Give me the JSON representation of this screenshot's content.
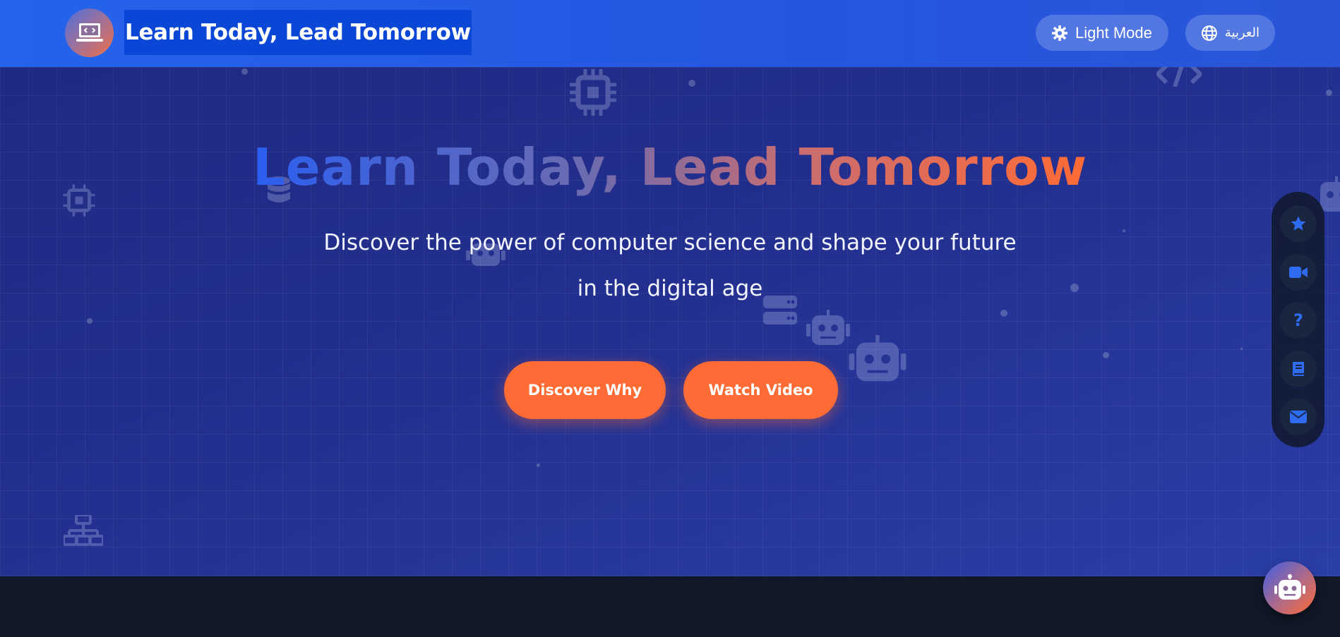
{
  "header": {
    "brand": "Learn Today, Lead Tomorrow",
    "theme_toggle_label": "Light Mode",
    "language_toggle_label": "العربية"
  },
  "hero": {
    "title": "Learn Today, Lead Tomorrow",
    "subtitle": "Discover the power of computer science and shape your future in the digital age",
    "primary_cta": "Discover Why",
    "secondary_cta": "Watch Video"
  },
  "dock": {
    "items": [
      {
        "icon": "star-icon",
        "glyph": "★"
      },
      {
        "icon": "video-icon",
        "glyph": ""
      },
      {
        "icon": "question-icon",
        "glyph": "?"
      },
      {
        "icon": "book-icon",
        "glyph": ""
      },
      {
        "icon": "envelope-icon",
        "glyph": ""
      }
    ]
  },
  "colors": {
    "header_bg": "#2563eb",
    "brand_highlight": "#0a47d6",
    "hero_bg": "#1e2a82",
    "cta": "#ff6b35",
    "dock_icon": "#2f6bf0",
    "footer_bg": "#111827"
  }
}
